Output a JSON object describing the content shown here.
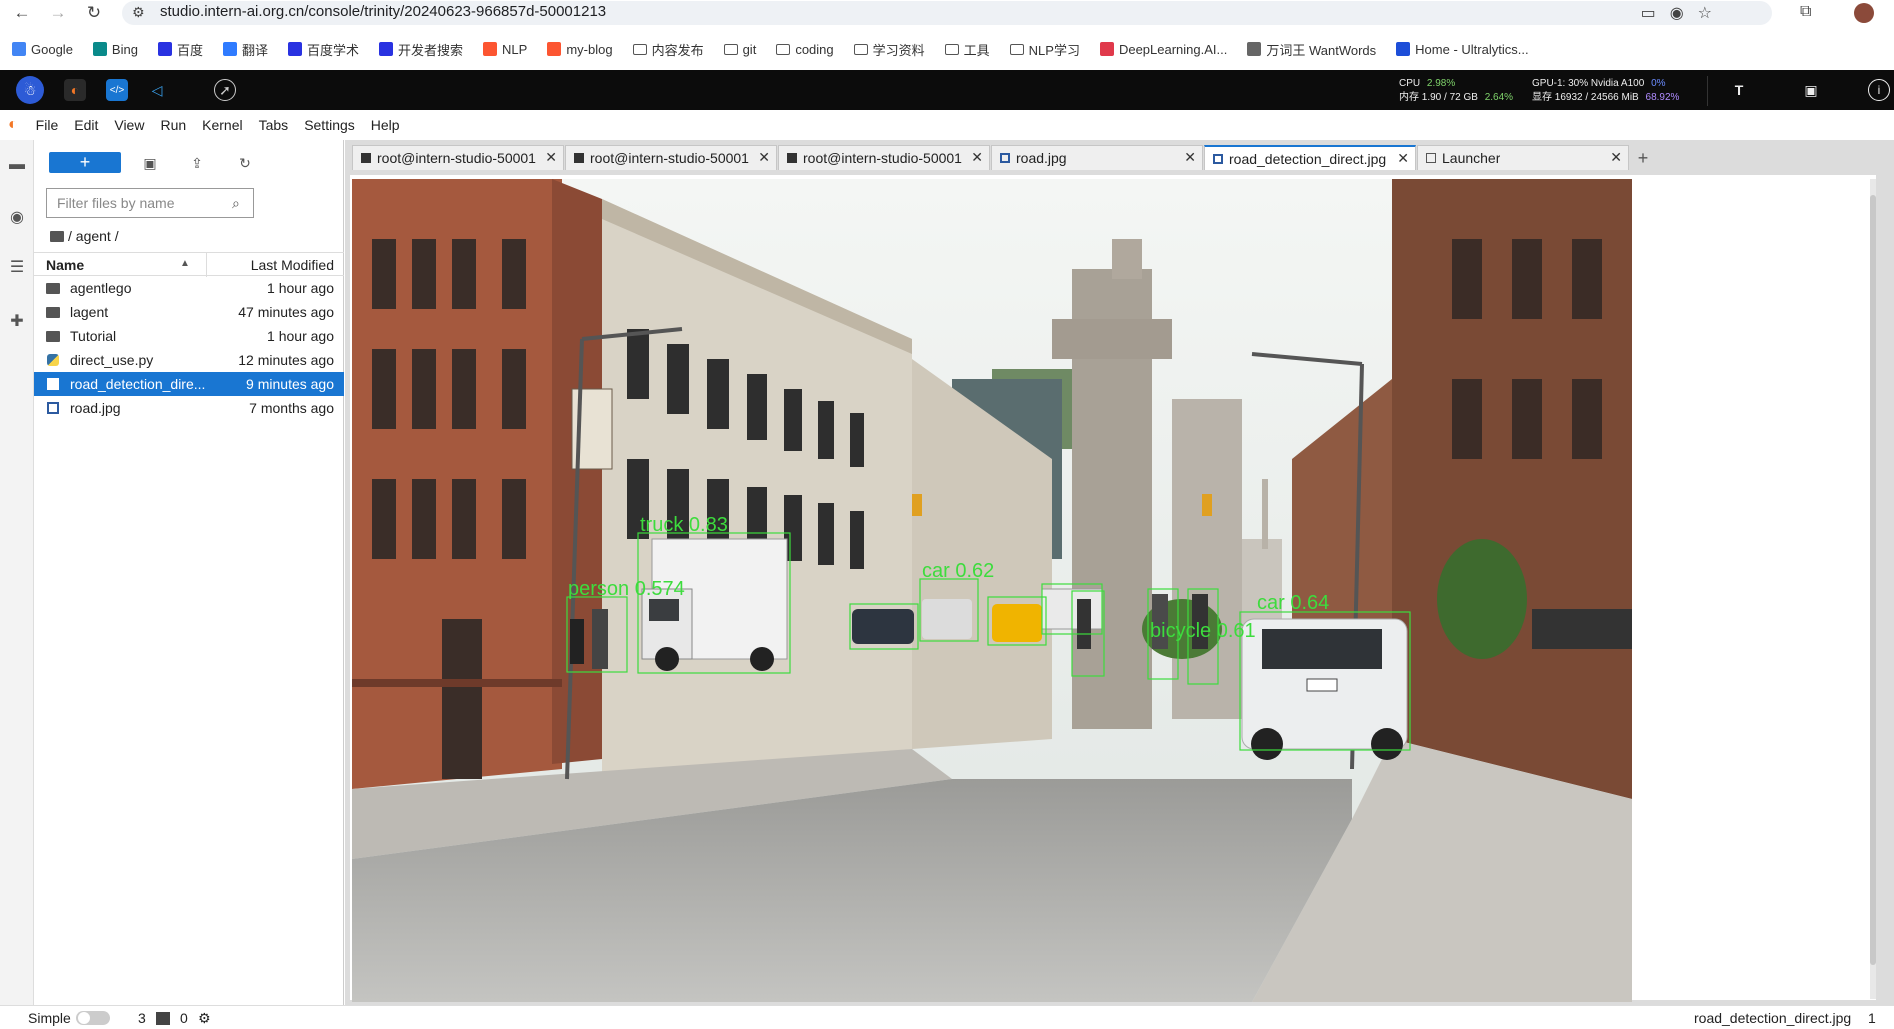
{
  "browser": {
    "url": "studio.intern-ai.org.cn/console/trinity/20240623-966857d-50001213",
    "bookmarks": [
      {
        "label": "Google",
        "icon": "google-icon",
        "color": "#4285f4"
      },
      {
        "label": "Bing",
        "icon": "bing-icon",
        "color": "#0a8a8a"
      },
      {
        "label": "百度",
        "icon": "baidu-icon",
        "color": "#2932e1"
      },
      {
        "label": "翻译",
        "icon": "translate-icon",
        "color": "#2f7bff"
      },
      {
        "label": "百度学术",
        "icon": "baidu-scholar-icon",
        "color": "#2932e1"
      },
      {
        "label": "开发者搜索",
        "icon": "dev-search-icon",
        "color": "#2932e1"
      },
      {
        "label": "NLP",
        "icon": "csdn-icon",
        "color": "#fc5531"
      },
      {
        "label": "my-blog",
        "icon": "csdn-icon",
        "color": "#fc5531"
      },
      {
        "label": "内容发布",
        "icon": "folder-icon",
        "color": "#555555"
      },
      {
        "label": "git",
        "icon": "folder-icon",
        "color": "#555555"
      },
      {
        "label": "coding",
        "icon": "folder-icon",
        "color": "#555555"
      },
      {
        "label": "学习资料",
        "icon": "folder-icon",
        "color": "#555555"
      },
      {
        "label": "工具",
        "icon": "folder-icon",
        "color": "#555555"
      },
      {
        "label": "NLP学习",
        "icon": "folder-icon",
        "color": "#555555"
      },
      {
        "label": "DeepLearning.AI...",
        "icon": "deeplearning-icon",
        "color": "#e0394b"
      },
      {
        "label": "万词王 WantWords",
        "icon": "wantwords-icon",
        "color": "#666666"
      },
      {
        "label": "Home - Ultralytics...",
        "icon": "ultralytics-icon",
        "color": "#1d4ed8"
      }
    ]
  },
  "resources": {
    "cpu_label": "CPU",
    "cpu_value": "2.98%",
    "mem_label": "内存 1.90 / 72 GB",
    "mem_pct": "2.64%",
    "gpu_label": "GPU-1: 30% Nvidia A100",
    "gpu_pct": "0%",
    "vram_label": "显存 16932 / 24566 MiB",
    "vram_pct": "68.92%"
  },
  "menu": [
    "File",
    "Edit",
    "View",
    "Run",
    "Kernel",
    "Tabs",
    "Settings",
    "Help"
  ],
  "filebrowser": {
    "new_label": "+",
    "filter_placeholder": "Filter files by name",
    "breadcrumb": "/ agent /",
    "col_name": "Name",
    "col_modified": "Last Modified",
    "files": [
      {
        "name": "agentlego",
        "modified": "1 hour ago",
        "type": "folder"
      },
      {
        "name": "lagent",
        "modified": "47 minutes ago",
        "type": "folder"
      },
      {
        "name": "Tutorial",
        "modified": "1 hour ago",
        "type": "folder"
      },
      {
        "name": "direct_use.py",
        "modified": "12 minutes ago",
        "type": "python"
      },
      {
        "name": "road_detection_dire...",
        "modified": "9 minutes ago",
        "type": "image",
        "selected": true
      },
      {
        "name": "road.jpg",
        "modified": "7 months ago",
        "type": "image"
      }
    ]
  },
  "tabs": [
    {
      "label": "root@intern-studio-50001",
      "type": "terminal"
    },
    {
      "label": "root@intern-studio-50001",
      "type": "terminal"
    },
    {
      "label": "root@intern-studio-50001",
      "type": "terminal"
    },
    {
      "label": "road.jpg",
      "type": "image"
    },
    {
      "label": "road_detection_direct.jpg",
      "type": "image",
      "active": true
    },
    {
      "label": "Launcher",
      "type": "launcher"
    }
  ],
  "tab_add": "+",
  "detections": [
    {
      "label": "truck 0.83"
    },
    {
      "label": "person 0.574"
    },
    {
      "label": "car 0.62"
    },
    {
      "label": "bicycle 0.61"
    },
    {
      "label": "car 0.64"
    }
  ],
  "statusbar": {
    "mode": "Simple",
    "terminals": "3",
    "kernels": "0",
    "file": "road_detection_direct.jpg",
    "num": "1"
  }
}
